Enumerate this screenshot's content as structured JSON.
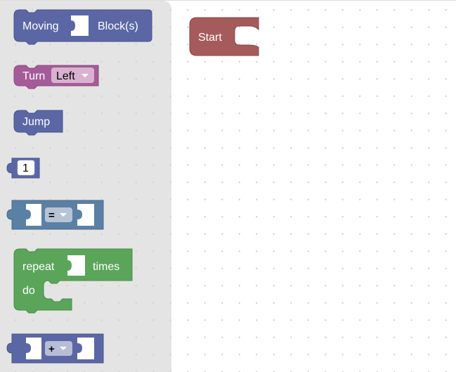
{
  "toolbox": {
    "moving_block": {
      "label_prefix": "Moving",
      "label_suffix": "Block(s)"
    },
    "turn_block": {
      "label": "Turn",
      "dropdown_value": "Left"
    },
    "jump_block": {
      "label": "Jump"
    },
    "number_block": {
      "value": "1"
    },
    "compare_block": {
      "operator": "="
    },
    "repeat_block": {
      "label_repeat": "repeat",
      "label_times": "times",
      "label_do": "do"
    },
    "arith_block": {
      "operator": "+"
    }
  },
  "workspace": {
    "start_block": {
      "label": "Start"
    }
  },
  "colors": {
    "motion_blue": "#5b67a5",
    "turn_purple": "#a55b99",
    "logic_blue": "#5b80a5",
    "loop_green": "#5ba55b",
    "start_red": "#a55b5b",
    "toolbox_bg": "#e4e4e4"
  }
}
